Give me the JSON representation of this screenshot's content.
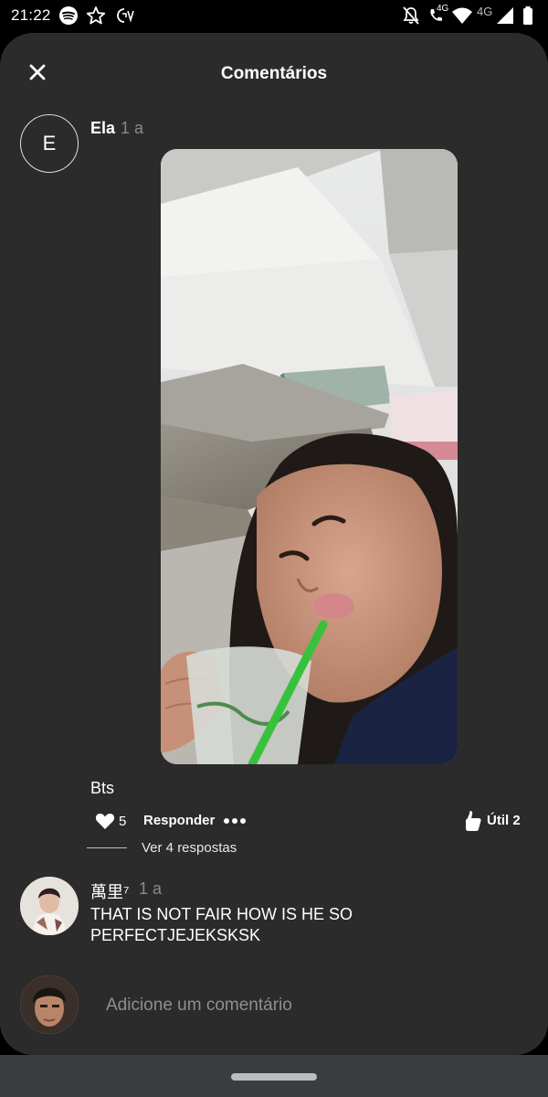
{
  "status_bar": {
    "time": "21:22",
    "network_labels": [
      "4G",
      "4G"
    ],
    "icons": [
      "spotify-icon",
      "star-icon",
      "app-icon",
      "mute-icon",
      "call-icon",
      "wifi-icon",
      "signal-icon",
      "battery-icon"
    ]
  },
  "header": {
    "title": "Comentários",
    "close_icon": "close-icon"
  },
  "comment": {
    "avatar_letter": "E",
    "username": "Ela",
    "age": "1 a",
    "text": "Bts",
    "likes": "5",
    "reply_label": "Responder",
    "useful_label": "Útil 2",
    "view_replies": "Ver 4 respostas"
  },
  "comment2": {
    "username": "萬里⁷",
    "age": "1 a",
    "text": "THAT IS NOT FAIR HOW IS HE SO PERFECTJEJEKSKSK"
  },
  "composer": {
    "placeholder": "Adicione um comentário"
  },
  "colors": {
    "sheet_bg": "#2b2b2b",
    "muted_text": "#8a8a8a",
    "nav_bg": "#3a3d40"
  }
}
